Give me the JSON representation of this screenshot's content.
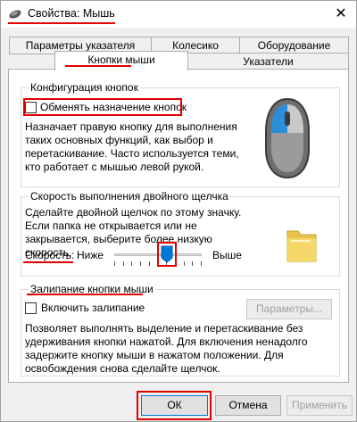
{
  "window": {
    "title": "Свойства: Мышь",
    "close_glyph": "✕"
  },
  "tabs": {
    "row1": [
      "Параметры указателя",
      "Колесико",
      "Оборудование"
    ],
    "row2": [
      "Кнопки мыши",
      "Указатели"
    ]
  },
  "buttons_config": {
    "group_title": "Конфигурация кнопок",
    "swap_label": "Обменять назначение кнопок",
    "description": "Назначает правую кнопку для выполнения таких основных функций, как выбор и перетаскивание. Часто используется теми, кто работает с мышью левой рукой."
  },
  "double_click": {
    "group_title": "Скорость выполнения двойного щелчка",
    "description": "Сделайте двойной щелчок по этому значку. Если папка не открывается или не закрывается, выберите более низкую скорость.",
    "speed_label": "Скорость:",
    "slow_label": "Ниже",
    "fast_label": "Выше",
    "speed_value": 0.6
  },
  "click_lock": {
    "group_title": "Залипание кнопки мыши",
    "enable_label": "Включить залипание",
    "params_button": "Параметры...",
    "description": "Позволяет выполнять выделение и перетаскивание без удерживания кнопки нажатой. Для включения ненадолго задержите кнопку мыши в нажатом положении. Для освобождения снова сделайте щелчок."
  },
  "footer": {
    "ok": "ОК",
    "cancel": "Отмена",
    "apply": "Применить"
  },
  "colors": {
    "highlight_red": "#e00000",
    "accent_blue": "#0078d7"
  }
}
